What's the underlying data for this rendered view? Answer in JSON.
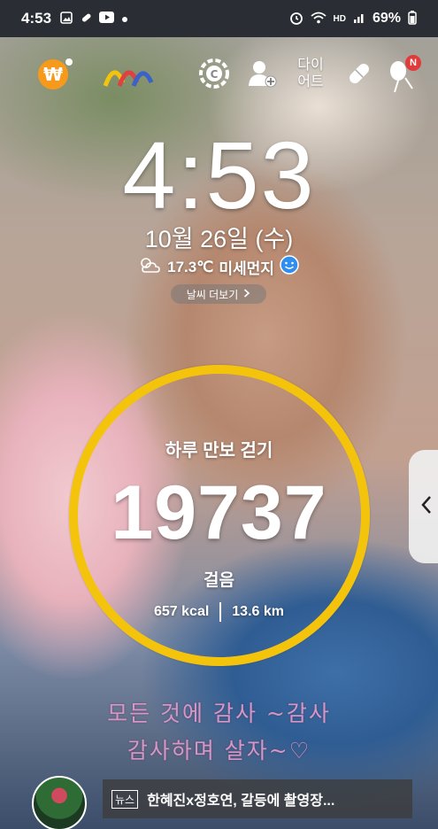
{
  "status_bar": {
    "time": "4:53",
    "battery": "69%",
    "network_label": "HD"
  },
  "top_shortcuts": {
    "diet_label": "다이\n어트",
    "notification_badge": "N"
  },
  "lockscreen": {
    "clock": "4:53",
    "date": "10월 26일 (수)",
    "temperature": "17.3℃",
    "air_quality": "미세먼지",
    "weather_more": "날씨 더보기"
  },
  "step_widget": {
    "title": "하루 만보 걷기",
    "steps": "19737",
    "unit": "걸음",
    "calories": "657 kcal",
    "distance": "13.6 km"
  },
  "overlay": {
    "line1": "모든 것에 감사 ~감사",
    "line2": "감사하며 살자~♡"
  },
  "news": {
    "tag": "뉴스",
    "headline": "한혜진x정호연, 갈등에 촬영장..."
  },
  "colors": {
    "ring": "#f4c40c",
    "overlay_text": "#d597c6",
    "badge": "#e03a3a"
  }
}
